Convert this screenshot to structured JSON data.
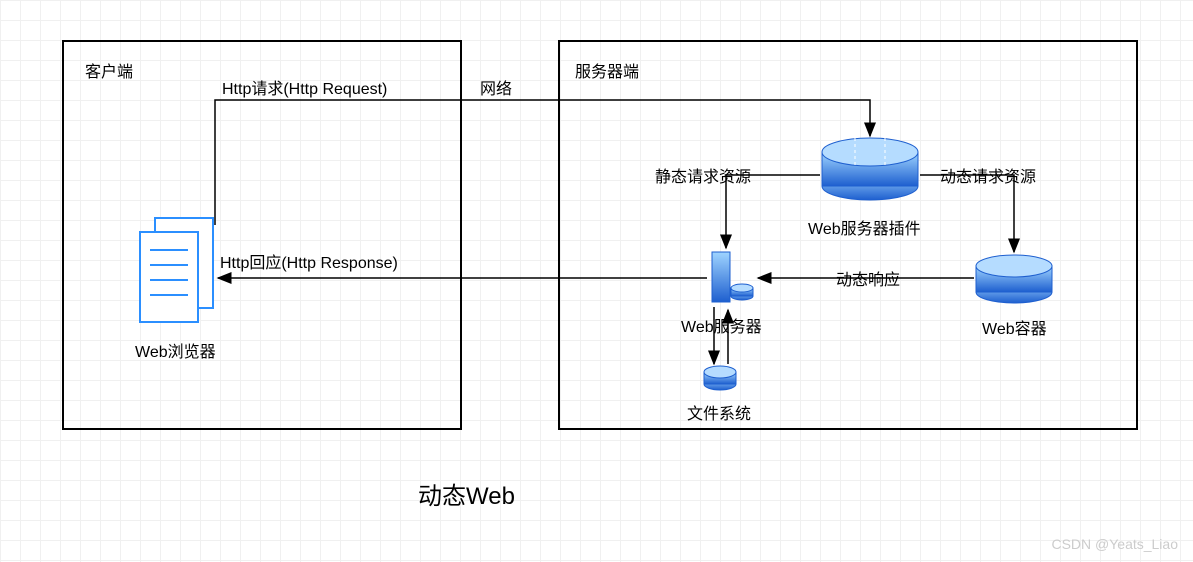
{
  "client": {
    "box_title": "客户端",
    "browser_label": "Web浏览器",
    "http_request": "Http请求(Http Request)",
    "http_response": "Http回应(Http Response)"
  },
  "network": "网络",
  "server": {
    "box_title": "服务器端",
    "static_request": "静态请求资源",
    "dynamic_request": "动态请求资源",
    "web_server_plugin": "Web服务器插件",
    "web_server": "Web服务器",
    "dynamic_response": "动态响应",
    "web_container": "Web容器",
    "file_system": "文件系统"
  },
  "title": "动态Web",
  "watermark": "CSDN @Yeats_Liao"
}
